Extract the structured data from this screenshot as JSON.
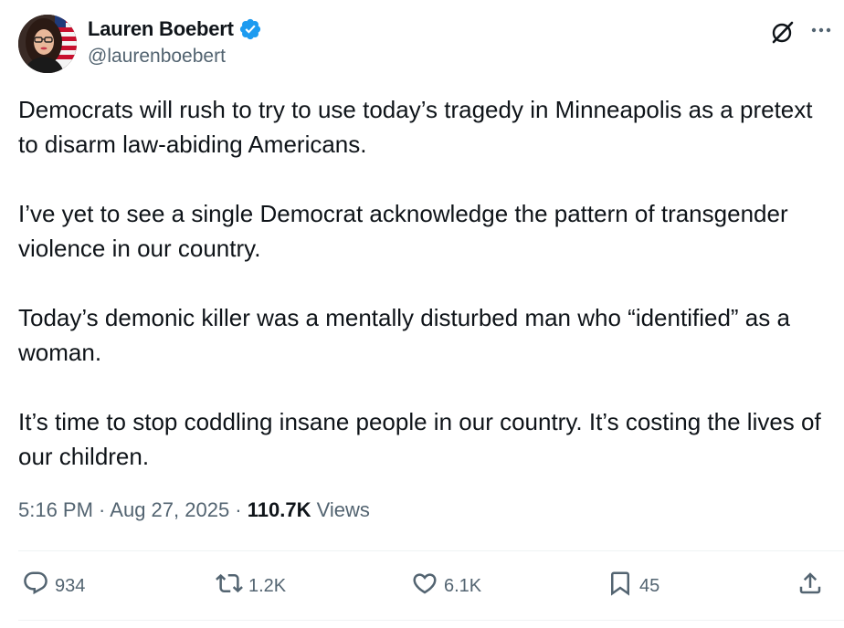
{
  "author": {
    "display_name": "Lauren Boebert",
    "handle": "@laurenboebert",
    "verified": true,
    "verified_color": "#1d9bf0"
  },
  "tweet": {
    "paragraphs": [
      "Democrats will rush to try to use today’s tragedy in Minneapolis as a pretext to disarm law-abiding Americans.",
      "I’ve yet to see a single Democrat acknowledge the pattern of transgender violence in our country.",
      "Today’s demonic killer was a mentally disturbed man who “identified” as a woman.",
      "It’s time to stop coddling insane people in our country. It’s costing the lives of our children."
    ],
    "time": "5:16 PM",
    "separator": " · ",
    "date": "Aug 27, 2025",
    "views_count": "110.7K",
    "views_label": "Views"
  },
  "actions": {
    "reply": {
      "icon": "reply-icon",
      "count": "934"
    },
    "repost": {
      "icon": "repost-icon",
      "count": "1.2K"
    },
    "like": {
      "icon": "heart-icon",
      "count": "6.1K"
    },
    "bookmark": {
      "icon": "bookmark-icon",
      "count": "45"
    },
    "share": {
      "icon": "share-icon"
    }
  },
  "colors": {
    "text_primary": "#0f1419",
    "text_secondary": "#536471",
    "divider": "#eff3f4"
  }
}
